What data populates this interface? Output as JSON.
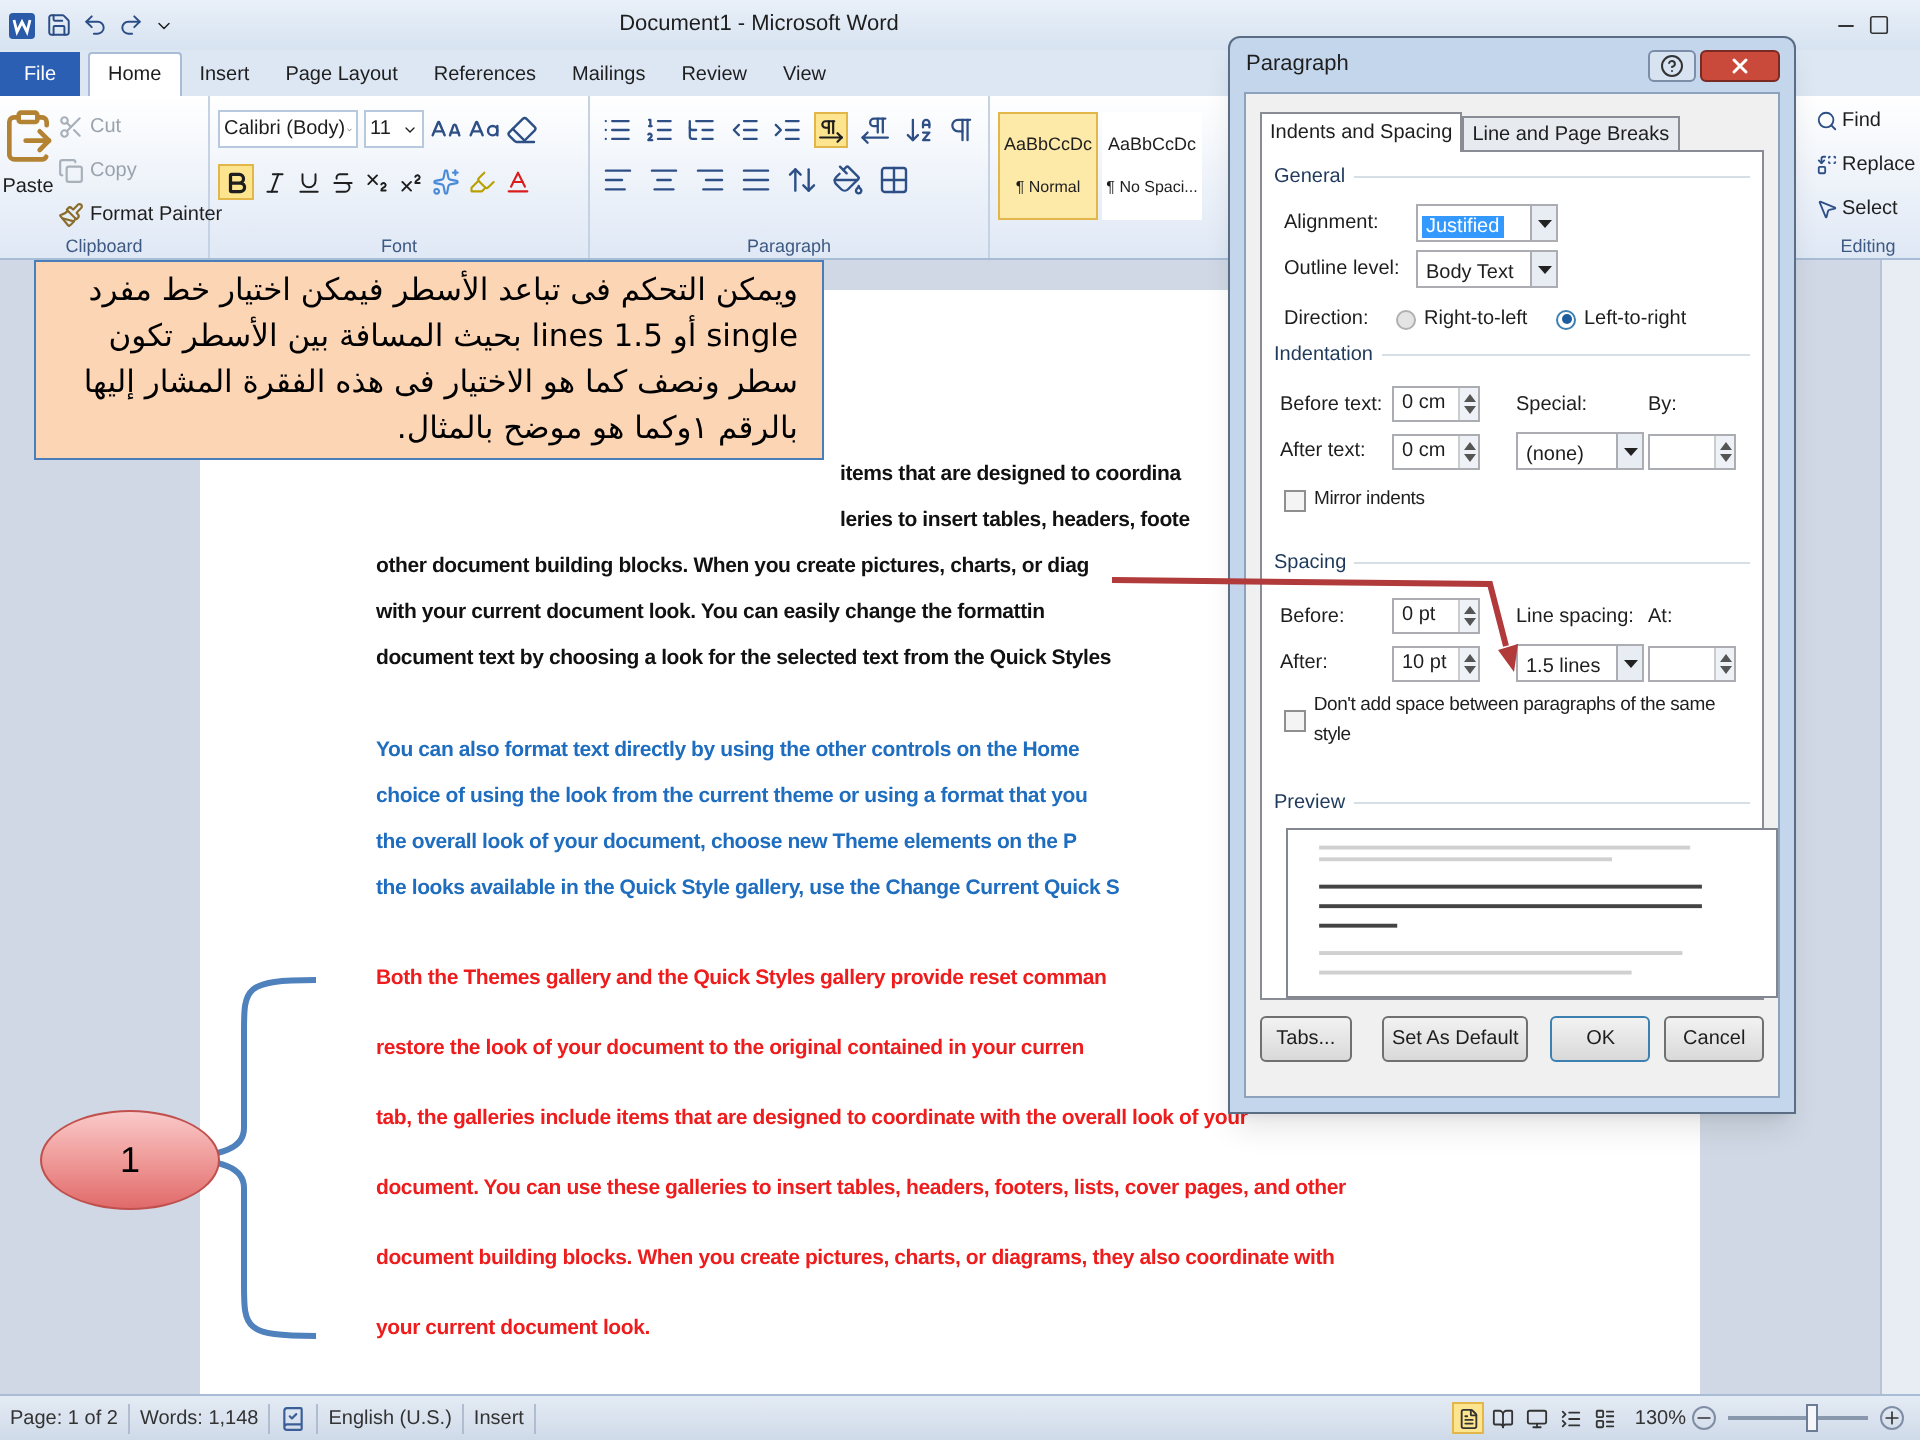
{
  "title_bar": {
    "title": "Document1 - Microsoft Word"
  },
  "ribbon_tabs": [
    {
      "label": "File",
      "kind": "file",
      "selected": false
    },
    {
      "label": "Home",
      "kind": "tab",
      "selected": true
    },
    {
      "label": "Insert",
      "kind": "tab",
      "selected": false
    },
    {
      "label": "Page Layout",
      "kind": "tab",
      "selected": false
    },
    {
      "label": "References",
      "kind": "tab",
      "selected": false
    },
    {
      "label": "Mailings",
      "kind": "tab",
      "selected": false
    },
    {
      "label": "Review",
      "kind": "tab",
      "selected": false
    },
    {
      "label": "View",
      "kind": "tab",
      "selected": false
    }
  ],
  "ribbon": {
    "clipboard": {
      "paste": "Paste",
      "items": [
        {
          "label": "Cut",
          "disabled": true
        },
        {
          "label": "Copy",
          "disabled": true
        },
        {
          "label": "Format Painter",
          "disabled": false
        }
      ],
      "label": "Clipboard"
    },
    "font": {
      "font_name": "Calibri (Body)",
      "font_size": "11",
      "bold_on": true,
      "label": "Font"
    },
    "paragraph": {
      "ltr_on": true,
      "label": "Paragraph"
    },
    "styles": [
      {
        "sample": "AaBbCcDc",
        "name": "¶ Normal",
        "selected": true
      },
      {
        "sample": "AaBbCcDc",
        "name": "¶ No Spaci...",
        "selected": false
      }
    ],
    "editing": {
      "items": [
        "Find",
        "Replace",
        "Select"
      ],
      "label": "Editing"
    }
  },
  "document": {
    "paragraphs": [
      {
        "color": "#111111",
        "kind": "single",
        "lines": [
          "items that are designed to coordina",
          "leries to insert tables, headers, foote",
          "other document building blocks. When you create pictures, charts, or diag",
          "with your current document look. You can easily change the formattin",
          "document text by choosing a look for the selected text from the Quick Styles"
        ]
      },
      {
        "color": "#1f6dbf",
        "kind": "single",
        "lines": [
          "You can also format text directly by using the other controls on the Home",
          "choice of using the look from the current theme or using a format that you",
          "the overall look of your document, choose new Theme elements on the P",
          "the looks available in the Quick Style gallery, use the Change Current Quick S"
        ]
      },
      {
        "color": "#ee1c1c",
        "kind": "spaced",
        "lines": [
          "Both the Themes gallery and the Quick Styles gallery provide reset comman",
          "restore the look of your document to the original contained in your curren",
          "tab, the galleries include items that are designed to coordinate with the overall look of your",
          "document. You can use these galleries to insert tables, headers, footers, lists, cover pages, and other",
          "document building blocks. When you create pictures, charts, or diagrams, they also coordinate with",
          "your current document look."
        ]
      }
    ]
  },
  "callout": {
    "text": "ويمكن التحكم فى تباعد الأسطر فيمكن اختيار خط مفرد single أو 1.5 lines بحيث المسافة بين الأسطر تكون سطر ونصف كما هو الاختيار فى هذه الفقرة المشار إليها بالرقم ١وكما هو موضح بالمثال."
  },
  "marker": {
    "number": "1"
  },
  "dialog": {
    "title": "Paragraph",
    "tabs": [
      {
        "label": "Indents and Spacing",
        "selected": true
      },
      {
        "label": "Line and Page Breaks",
        "selected": false
      }
    ],
    "general": {
      "heading": "General",
      "alignment": {
        "label": "Alignment:",
        "value": "Justified"
      },
      "outline_level": {
        "label": "Outline level:",
        "value": "Body Text"
      },
      "direction": {
        "label": "Direction:",
        "options": [
          {
            "label": "Right-to-left",
            "selected": false
          },
          {
            "label": "Left-to-right",
            "selected": true
          }
        ]
      }
    },
    "indentation": {
      "heading": "Indentation",
      "before": {
        "label": "Before text:",
        "value": "0 cm"
      },
      "after": {
        "label": "After text:",
        "value": "0 cm"
      },
      "special": {
        "label": "Special:",
        "value": "(none)"
      },
      "by": {
        "label": "By:"
      },
      "mirror": {
        "label": "Mirror indents",
        "checked": false
      }
    },
    "spacing": {
      "heading": "Spacing",
      "before": {
        "label": "Before:",
        "value": "0 pt"
      },
      "after": {
        "label": "After:",
        "value": "10 pt"
      },
      "line_spacing": {
        "label": "Line spacing:",
        "value": "1.5 lines"
      },
      "at": {
        "label": "At:"
      },
      "dont_add": {
        "label": "Don't add space between paragraphs of the same style",
        "checked": false
      }
    },
    "preview": {
      "heading": "Preview"
    },
    "buttons": [
      "Tabs...",
      "Set As Default",
      "OK",
      "Cancel"
    ]
  },
  "status_bar": {
    "page": "Page: 1 of 2",
    "words": "Words: 1,148",
    "language": "English (U.S.)",
    "mode": "Insert",
    "views": [
      {
        "selected": true
      },
      {
        "selected": false
      },
      {
        "selected": false
      },
      {
        "selected": false
      },
      {
        "selected": false
      }
    ],
    "zoom": {
      "reading": "130%",
      "level": 0.6
    }
  }
}
